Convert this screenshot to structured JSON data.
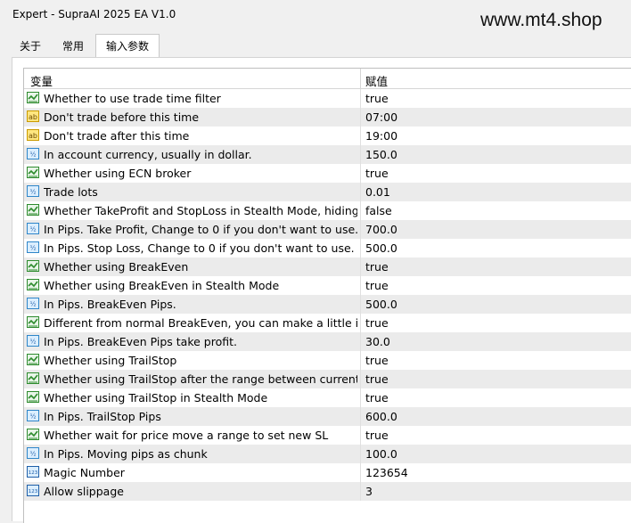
{
  "window": {
    "title": "Expert - SupraAI 2025 EA V1.0",
    "watermark": "www.mt4.shop"
  },
  "tabs": [
    {
      "label": "关于"
    },
    {
      "label": "常用"
    },
    {
      "label": "输入参数",
      "active": true
    }
  ],
  "table": {
    "headers": {
      "variable": "变量",
      "value": "赋值"
    },
    "rows": [
      {
        "icon": "bool-icon",
        "name": "Whether to use trade time filter",
        "value": "true"
      },
      {
        "icon": "string-icon",
        "name": "Don't trade before this time",
        "value": "07:00"
      },
      {
        "icon": "string-icon",
        "name": "Don't trade after this time",
        "value": "19:00"
      },
      {
        "icon": "double-icon",
        "name": "In account currency, usually in dollar.",
        "value": "150.0"
      },
      {
        "icon": "bool-icon",
        "name": "Whether using ECN broker",
        "value": "true"
      },
      {
        "icon": "double-icon",
        "name": "Trade lots",
        "value": "0.01"
      },
      {
        "icon": "bool-icon",
        "name": "Whether TakeProfit and StopLoss in Stealth Mode, hiding f...",
        "value": "false"
      },
      {
        "icon": "double-icon",
        "name": "In Pips. Take Profit, Change to 0 if you don't want to use.",
        "value": "700.0"
      },
      {
        "icon": "double-icon",
        "name": "In Pips. Stop Loss, Change to 0 if you don't want to use.",
        "value": "500.0"
      },
      {
        "icon": "bool-icon",
        "name": "Whether using BreakEven",
        "value": "true"
      },
      {
        "icon": "bool-icon",
        "name": "Whether using BreakEven in Stealth Mode",
        "value": "true"
      },
      {
        "icon": "double-icon",
        "name": "In Pips. BreakEven Pips.",
        "value": "500.0"
      },
      {
        "icon": "bool-icon",
        "name": "Different from normal BreakEven, you can make a little in ...",
        "value": "true"
      },
      {
        "icon": "double-icon",
        "name": "In Pips. BreakEven Pips take profit.",
        "value": "30.0"
      },
      {
        "icon": "bool-icon",
        "name": "Whether using TrailStop",
        "value": "true"
      },
      {
        "icon": "bool-icon",
        "name": "Whether using TrailStop after the range between current p...",
        "value": "true"
      },
      {
        "icon": "bool-icon",
        "name": "Whether using TrailStop in Stealth Mode",
        "value": "true"
      },
      {
        "icon": "double-icon",
        "name": "In Pips. TrailStop Pips",
        "value": "600.0"
      },
      {
        "icon": "bool-icon",
        "name": "Whether wait for price move a range to set new SL",
        "value": "true"
      },
      {
        "icon": "double-icon",
        "name": "In Pips. Moving pips as chunk",
        "value": "100.0"
      },
      {
        "icon": "int-icon",
        "name": "Magic Number",
        "value": "123654"
      },
      {
        "icon": "int-icon",
        "name": "Allow slippage",
        "value": "3"
      }
    ]
  },
  "colors": {
    "row_alt": "#ebebeb",
    "bool_icon": "#2e8b2e",
    "string_icon": "#e0b000",
    "double_icon": "#2f86c9",
    "int_icon": "#1f5fa8"
  }
}
